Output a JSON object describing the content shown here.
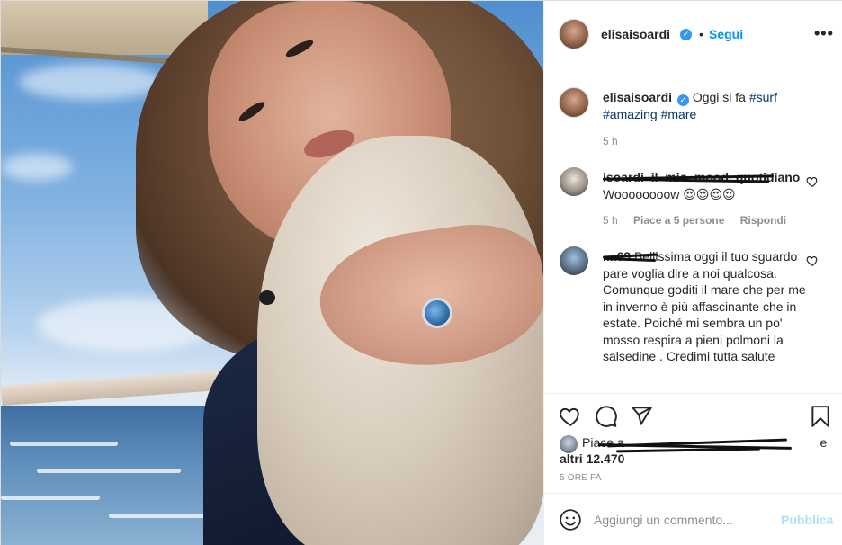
{
  "post": {
    "username": "elisaisoardi",
    "dot": "•",
    "follow_label": "Segui",
    "more_icon": "more-options-icon",
    "verified_mark": "✓"
  },
  "caption": {
    "username": "elisaisoardi",
    "text_plain": "Oggi si fa",
    "hashtag1": "#surf",
    "hashtag2": "#amazing",
    "hashtag3": "#mare",
    "time": "5 h"
  },
  "comments": [
    {
      "username": "isoardi_il_mio_mood_quotidiano",
      "text": "Woooooooow 😍😍😍😍",
      "time": "5 h",
      "likes": "Piace a 5 persone",
      "reply": "Rispondi"
    },
    {
      "username": "....63",
      "text": "Bellissima oggi il tuo sguardo pare voglia dire a noi qualcosa. Comunque goditi il mare che per me in inverno è più affascinante che in estate. Poiché mi sembra un po' mosso respira a pieni polmoni la salsedine . Credimi tutta salute"
    }
  ],
  "actions": {
    "like_icon": "heart-icon",
    "comment_icon": "comment-icon",
    "share_icon": "share-icon",
    "save_icon": "bookmark-icon"
  },
  "likes": {
    "prefix": "Piace a",
    "suffix": "e",
    "others": "altri 12.470"
  },
  "time_ago": "5 ORE FA",
  "add_comment": {
    "emoji_icon": "emoji-icon",
    "placeholder": "Aggiungi un commento...",
    "publish_label": "Pubblica"
  },
  "colors": {
    "link": "#0095f6",
    "hashtag": "#00376b",
    "muted": "#8e8e8e",
    "publish_disabled": "#b2dffc"
  }
}
